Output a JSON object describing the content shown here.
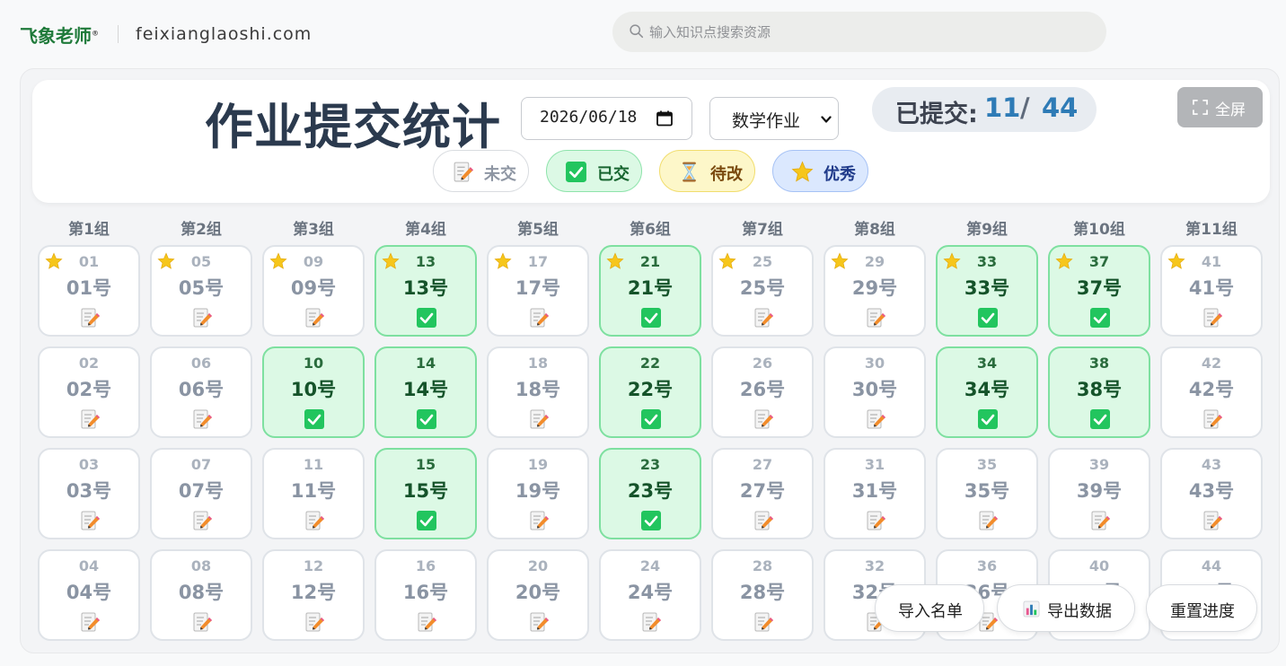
{
  "site": {
    "brand": "飞象老师",
    "brand_mark": "®",
    "domain": "feixianglaoshi.com",
    "search_placeholder": "输入知识点搜索资源"
  },
  "header": {
    "title": "作业提交统计",
    "date_value": "2026/06/18",
    "subject_value": "数学作业",
    "submitted_label": "已提交:",
    "submitted_count": "11",
    "slash": "/",
    "total_count": "44",
    "fullscreen_label": "全屏"
  },
  "legend": [
    {
      "key": "unsub",
      "label": "未交",
      "icon": "memo-icon"
    },
    {
      "key": "done",
      "label": "已交",
      "icon": "check-box-icon"
    },
    {
      "key": "review",
      "label": "待改",
      "icon": "hourglass-icon"
    },
    {
      "key": "excellent",
      "label": "优秀",
      "icon": "star-icon"
    }
  ],
  "groups": [
    {
      "label": "第1组",
      "students": [
        {
          "seat": "01",
          "name": "01号",
          "status": "unsub",
          "star": true
        },
        {
          "seat": "02",
          "name": "02号",
          "status": "unsub",
          "star": false
        },
        {
          "seat": "03",
          "name": "03号",
          "status": "unsub",
          "star": false
        },
        {
          "seat": "04",
          "name": "04号",
          "status": "unsub",
          "star": false
        }
      ]
    },
    {
      "label": "第2组",
      "students": [
        {
          "seat": "05",
          "name": "05号",
          "status": "unsub",
          "star": true
        },
        {
          "seat": "06",
          "name": "06号",
          "status": "unsub",
          "star": false
        },
        {
          "seat": "07",
          "name": "07号",
          "status": "unsub",
          "star": false
        },
        {
          "seat": "08",
          "name": "08号",
          "status": "unsub",
          "star": false
        }
      ]
    },
    {
      "label": "第3组",
      "students": [
        {
          "seat": "09",
          "name": "09号",
          "status": "unsub",
          "star": true
        },
        {
          "seat": "10",
          "name": "10号",
          "status": "done",
          "star": false
        },
        {
          "seat": "11",
          "name": "11号",
          "status": "unsub",
          "star": false
        },
        {
          "seat": "12",
          "name": "12号",
          "status": "unsub",
          "star": false
        }
      ]
    },
    {
      "label": "第4组",
      "students": [
        {
          "seat": "13",
          "name": "13号",
          "status": "done",
          "star": true
        },
        {
          "seat": "14",
          "name": "14号",
          "status": "done",
          "star": false
        },
        {
          "seat": "15",
          "name": "15号",
          "status": "done",
          "star": false
        },
        {
          "seat": "16",
          "name": "16号",
          "status": "unsub",
          "star": false
        }
      ]
    },
    {
      "label": "第5组",
      "students": [
        {
          "seat": "17",
          "name": "17号",
          "status": "unsub",
          "star": true
        },
        {
          "seat": "18",
          "name": "18号",
          "status": "unsub",
          "star": false
        },
        {
          "seat": "19",
          "name": "19号",
          "status": "unsub",
          "star": false
        },
        {
          "seat": "20",
          "name": "20号",
          "status": "unsub",
          "star": false
        }
      ]
    },
    {
      "label": "第6组",
      "students": [
        {
          "seat": "21",
          "name": "21号",
          "status": "done",
          "star": true
        },
        {
          "seat": "22",
          "name": "22号",
          "status": "done",
          "star": false
        },
        {
          "seat": "23",
          "name": "23号",
          "status": "done",
          "star": false
        },
        {
          "seat": "24",
          "name": "24号",
          "status": "unsub",
          "star": false
        }
      ]
    },
    {
      "label": "第7组",
      "students": [
        {
          "seat": "25",
          "name": "25号",
          "status": "unsub",
          "star": true
        },
        {
          "seat": "26",
          "name": "26号",
          "status": "unsub",
          "star": false
        },
        {
          "seat": "27",
          "name": "27号",
          "status": "unsub",
          "star": false
        },
        {
          "seat": "28",
          "name": "28号",
          "status": "unsub",
          "star": false
        }
      ]
    },
    {
      "label": "第8组",
      "students": [
        {
          "seat": "29",
          "name": "29号",
          "status": "unsub",
          "star": true
        },
        {
          "seat": "30",
          "name": "30号",
          "status": "unsub",
          "star": false
        },
        {
          "seat": "31",
          "name": "31号",
          "status": "unsub",
          "star": false
        },
        {
          "seat": "32",
          "name": "32号",
          "status": "unsub",
          "star": false
        }
      ]
    },
    {
      "label": "第9组",
      "students": [
        {
          "seat": "33",
          "name": "33号",
          "status": "done",
          "star": true
        },
        {
          "seat": "34",
          "name": "34号",
          "status": "done",
          "star": false
        },
        {
          "seat": "35",
          "name": "35号",
          "status": "unsub",
          "star": false
        },
        {
          "seat": "36",
          "name": "36号",
          "status": "unsub",
          "star": false
        }
      ]
    },
    {
      "label": "第10组",
      "students": [
        {
          "seat": "37",
          "name": "37号",
          "status": "done",
          "star": true
        },
        {
          "seat": "38",
          "name": "38号",
          "status": "done",
          "star": false
        },
        {
          "seat": "39",
          "name": "39号",
          "status": "unsub",
          "star": false
        },
        {
          "seat": "40",
          "name": "40号",
          "status": "unsub",
          "star": false
        }
      ]
    },
    {
      "label": "第11组",
      "students": [
        {
          "seat": "41",
          "name": "41号",
          "status": "unsub",
          "star": true
        },
        {
          "seat": "42",
          "name": "42号",
          "status": "unsub",
          "star": false
        },
        {
          "seat": "43",
          "name": "43号",
          "status": "unsub",
          "star": false
        },
        {
          "seat": "44",
          "name": "44号",
          "status": "unsub",
          "star": false
        }
      ]
    }
  ],
  "actions": {
    "import_label": "导入名单",
    "export_label": "导出数据",
    "export_icon": "bar-chart-icon",
    "reset_label": "重置进度"
  },
  "colors": {
    "brand_green": "#1f7a3a",
    "title_navy": "#2b3a4e",
    "count_blue": "#2e7bb6",
    "done_bg": "#dcf9e5",
    "done_border": "#7ee0a0",
    "check_green": "#22c55e",
    "star_yellow": "#f6c61b"
  }
}
